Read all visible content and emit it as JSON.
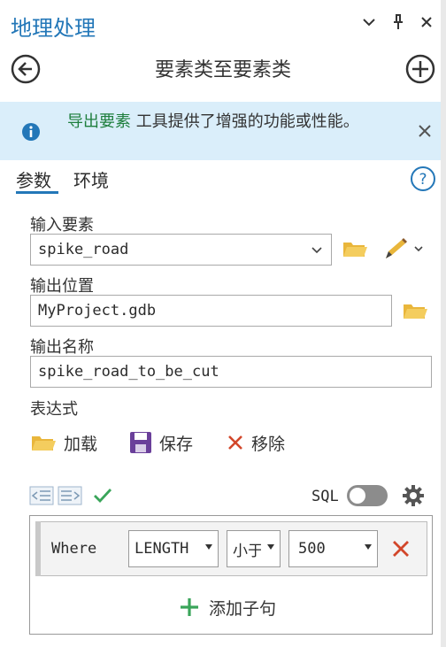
{
  "pane": {
    "title": "地理处理"
  },
  "header": {
    "tool_title": "要素类至要素类"
  },
  "banner": {
    "link_text": "导出要素",
    "message": " 工具提供了增强的功能或性能。"
  },
  "tabs": [
    {
      "label": "参数"
    },
    {
      "label": "环境"
    }
  ],
  "params": {
    "input_features": {
      "label": "输入要素",
      "value": "spike_road"
    },
    "output_location": {
      "label": "输出位置",
      "value": "MyProject.gdb"
    },
    "output_name": {
      "label": "输出名称",
      "value": "spike_road_to_be_cut"
    },
    "expression": {
      "label": "表达式"
    }
  },
  "expression_toolbar": {
    "load_label": "加载",
    "save_label": "保存",
    "remove_label": "移除",
    "sql_label": "SQL"
  },
  "clause": {
    "where_label": "Where",
    "field": "LENGTH",
    "operator": "小于",
    "value": "500",
    "add_clause_label": "添加子句"
  },
  "colors": {
    "accent": "#2377b8",
    "banner_bg": "#daeefa",
    "link_green": "#1f7f3e",
    "folder_yellow": "#e9b63b",
    "remove_red": "#d2462a",
    "add_green": "#3aa55a"
  }
}
